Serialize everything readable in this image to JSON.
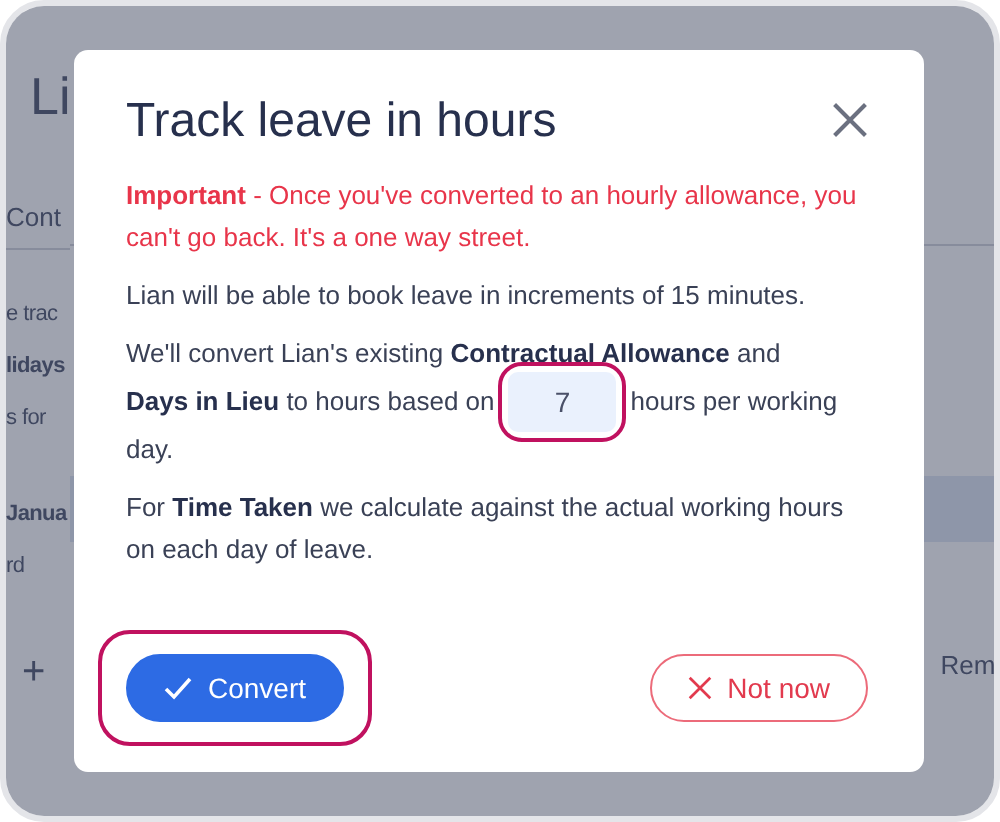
{
  "background": {
    "heading": "Li",
    "tab": "Cont",
    "lines": [
      {
        "text": "e trac",
        "bold": false
      },
      {
        "text": "lidays",
        "bold": true
      },
      {
        "text": "s for",
        "bold": false
      },
      {
        "text": "Janua",
        "bold": true
      },
      {
        "text": "rd",
        "bold": false
      }
    ],
    "add_button": "+",
    "column_header": "Rem"
  },
  "dialog": {
    "title": "Track leave in hours",
    "warning": "**Important** - Once you've converted to an hourly allowance, you can't go back. It's a one way street.",
    "info": "Lian will be able to book leave in increments of 15 minutes.",
    "conversion": {
      "first_line": "We'll convert Lian's existing **Contractual Allowance** and",
      "before": "**Days in Lieu** to hours based on",
      "hours": "7",
      "after": "hours per working",
      "last_line": "day.",
      "highlighted": true
    },
    "note": "For **Time Taken** we calculate against the actual working hours on each day of leave.",
    "buttons": [
      {
        "label": "Convert",
        "kind": "primary",
        "highlighted": true
      },
      {
        "label": "Not now",
        "kind": "secondary",
        "highlighted": false
      }
    ]
  }
}
